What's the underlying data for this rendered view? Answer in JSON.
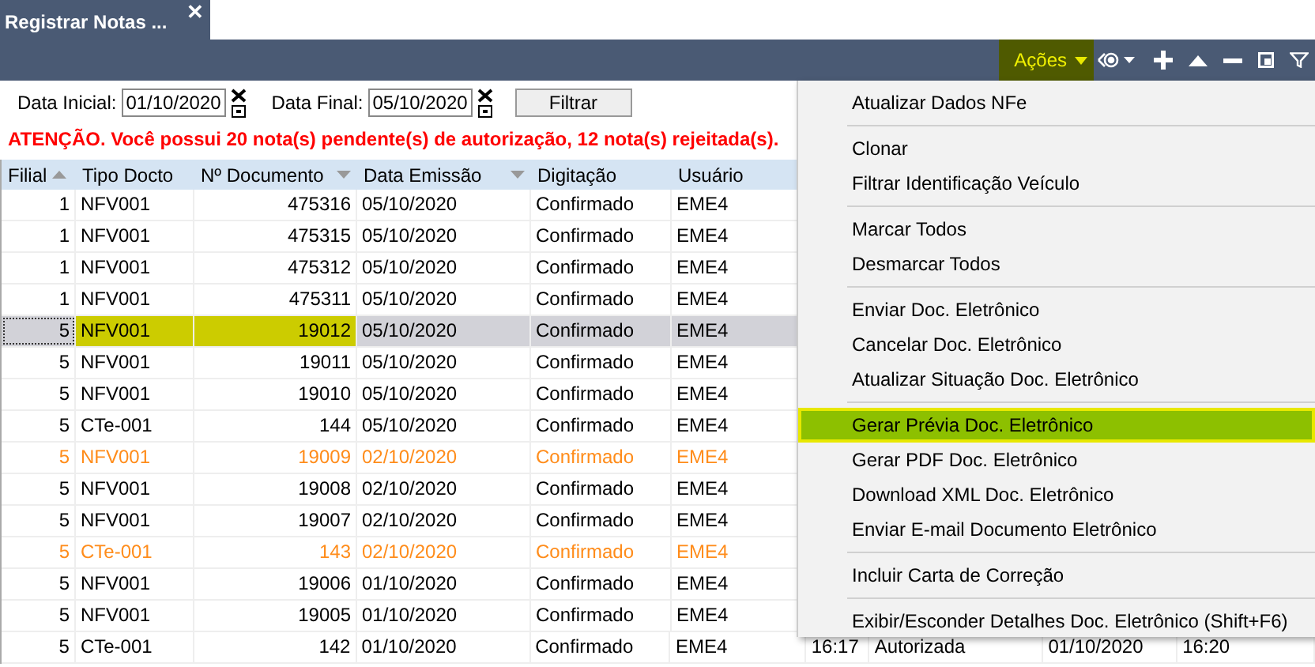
{
  "tab": {
    "title": "Registrar Notas ...",
    "close": "✕"
  },
  "toolbar": {
    "actions_label": "Ações"
  },
  "filter": {
    "start_label": "Data Inicial:",
    "start_value": "01/10/2020",
    "end_label": "Data Final:",
    "end_value": "05/10/2020",
    "button": "Filtrar"
  },
  "warning": "ATENÇÃO. Você possui 20 nota(s) pendente(s) de autorização, 12 nota(s) rejeitada(s).",
  "table": {
    "columns": [
      {
        "label": "Filial",
        "sorted_ascending": true,
        "sorted_descending": false
      },
      {
        "label": "Tipo Docto",
        "sorted_ascending": false,
        "sorted_descending": false
      },
      {
        "label": "Nº Documento",
        "sorted_ascending": false,
        "sorted_descending": true
      },
      {
        "label": "Data Emissão",
        "sorted_ascending": false,
        "sorted_descending": true
      },
      {
        "label": "Digitação",
        "sorted_ascending": false,
        "sorted_descending": false
      },
      {
        "label": "Usuário",
        "sorted_ascending": false,
        "sorted_descending": false
      }
    ],
    "rows": [
      {
        "cells": [
          "1",
          "NFV001",
          "475316",
          "05/10/2020",
          "Confirmado",
          "EME4"
        ],
        "selected": false,
        "color": "#000000"
      },
      {
        "cells": [
          "1",
          "NFV001",
          "475315",
          "05/10/2020",
          "Confirmado",
          "EME4"
        ],
        "selected": false,
        "color": "#000000"
      },
      {
        "cells": [
          "1",
          "NFV001",
          "475312",
          "05/10/2020",
          "Confirmado",
          "EME4"
        ],
        "selected": false,
        "color": "#000000"
      },
      {
        "cells": [
          "1",
          "NFV001",
          "475311",
          "05/10/2020",
          "Confirmado",
          "EME4"
        ],
        "selected": false,
        "color": "#000000"
      },
      {
        "cells": [
          "5",
          "NFV001",
          "19012",
          "05/10/2020",
          "Confirmado",
          "EME4"
        ],
        "selected": true,
        "color": "#000000"
      },
      {
        "cells": [
          "5",
          "NFV001",
          "19011",
          "05/10/2020",
          "Confirmado",
          "EME4"
        ],
        "selected": false,
        "color": "#000000"
      },
      {
        "cells": [
          "5",
          "NFV001",
          "19010",
          "05/10/2020",
          "Confirmado",
          "EME4"
        ],
        "selected": false,
        "color": "#000000"
      },
      {
        "cells": [
          "5",
          "CTe-001",
          "144",
          "05/10/2020",
          "Confirmado",
          "EME4"
        ],
        "selected": false,
        "color": "#000000"
      },
      {
        "cells": [
          "5",
          "NFV001",
          "19009",
          "02/10/2020",
          "Confirmado",
          "EME4"
        ],
        "selected": false,
        "color": "#ff8c1a"
      },
      {
        "cells": [
          "5",
          "NFV001",
          "19008",
          "02/10/2020",
          "Confirmado",
          "EME4"
        ],
        "selected": false,
        "color": "#000000"
      },
      {
        "cells": [
          "5",
          "NFV001",
          "19007",
          "02/10/2020",
          "Confirmado",
          "EME4"
        ],
        "selected": false,
        "color": "#000000"
      },
      {
        "cells": [
          "5",
          "CTe-001",
          "143",
          "02/10/2020",
          "Confirmado",
          "EME4"
        ],
        "selected": false,
        "color": "#ff8c1a"
      },
      {
        "cells": [
          "5",
          "NFV001",
          "19006",
          "01/10/2020",
          "Confirmado",
          "EME4"
        ],
        "selected": false,
        "color": "#000000"
      },
      {
        "cells": [
          "5",
          "NFV001",
          "19005",
          "01/10/2020",
          "Confirmado",
          "EME4"
        ],
        "selected": false,
        "color": "#000000"
      },
      {
        "cells": [
          "5",
          "CTe-001",
          "142",
          "01/10/2020",
          "Confirmado",
          "EME4",
          "16:17",
          "Autorizada",
          "01/10/2020",
          "16:20"
        ],
        "selected": false,
        "color": "#000000"
      }
    ]
  },
  "menu": [
    {
      "kind": "item",
      "label": "Atualizar Dados NFe",
      "selected": false
    },
    {
      "kind": "separator"
    },
    {
      "kind": "item",
      "label": "Clonar",
      "selected": false
    },
    {
      "kind": "item",
      "label": "Filtrar Identificação Veículo",
      "selected": false
    },
    {
      "kind": "separator"
    },
    {
      "kind": "item",
      "label": "Marcar Todos",
      "selected": false
    },
    {
      "kind": "item",
      "label": "Desmarcar Todos",
      "selected": false
    },
    {
      "kind": "separator"
    },
    {
      "kind": "item",
      "label": "Enviar Doc. Eletrônico",
      "selected": false
    },
    {
      "kind": "item",
      "label": "Cancelar Doc. Eletrônico",
      "selected": false
    },
    {
      "kind": "item",
      "label": "Atualizar Situação Doc. Eletrônico",
      "selected": false
    },
    {
      "kind": "separator"
    },
    {
      "kind": "item",
      "label": "Gerar Prévia Doc. Eletrônico",
      "selected": true
    },
    {
      "kind": "item",
      "label": "Gerar PDF Doc. Eletrônico",
      "selected": false
    },
    {
      "kind": "item",
      "label": "Download XML Doc. Eletrônico",
      "selected": false
    },
    {
      "kind": "item",
      "label": "Enviar E-mail Documento Eletrônico",
      "selected": false
    },
    {
      "kind": "separator"
    },
    {
      "kind": "item",
      "label": "Incluir Carta de Correção",
      "selected": false
    },
    {
      "kind": "separator"
    },
    {
      "kind": "item",
      "label": "Exibir/Esconder Detalhes Doc. Eletrônico (Shift+F6)",
      "selected": false
    }
  ]
}
